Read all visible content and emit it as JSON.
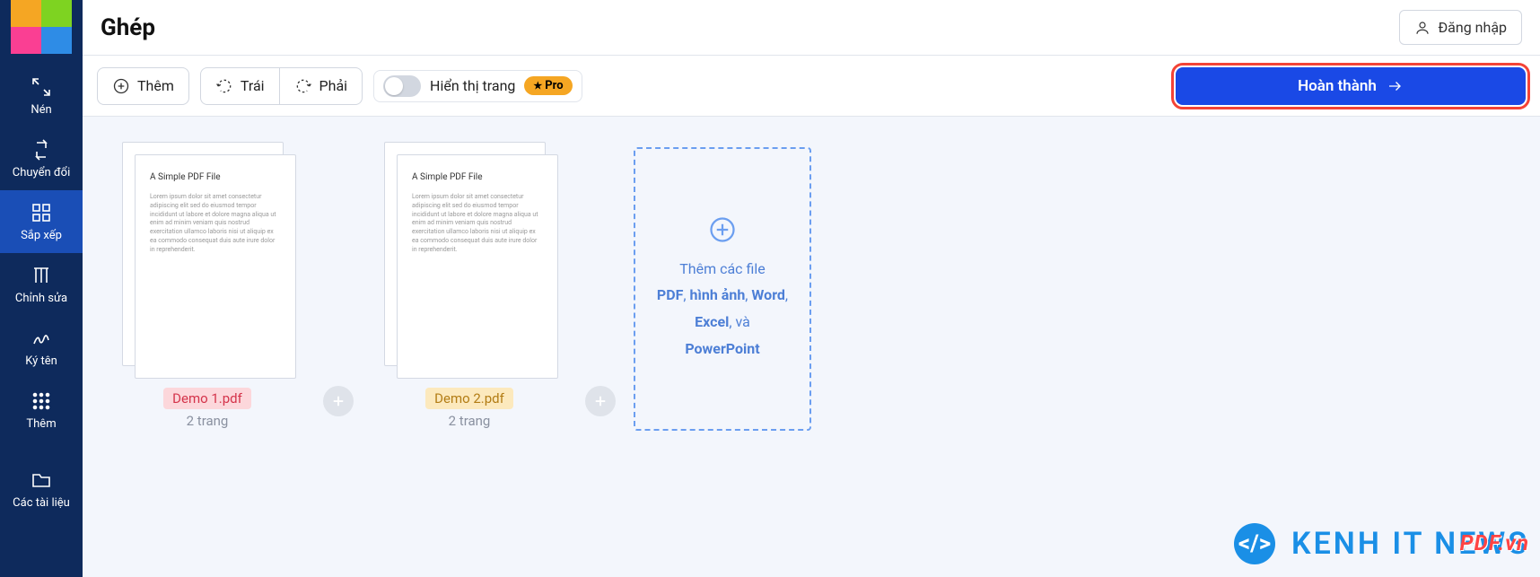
{
  "header": {
    "title": "Ghép",
    "login": "Đăng nhập"
  },
  "toolbar": {
    "add": "Thêm",
    "rotate_left": "Trái",
    "rotate_right": "Phải",
    "toggle_label": "Hiển thị trang",
    "pro": "Pro",
    "finish": "Hoàn thành"
  },
  "sidebar": {
    "items": [
      {
        "label": "Nén"
      },
      {
        "label": "Chuyển đổi"
      },
      {
        "label": "Sắp xếp"
      },
      {
        "label": "Chỉnh sửa"
      },
      {
        "label": "Ký tên"
      },
      {
        "label": "Thêm"
      },
      {
        "label": "Các tài liệu"
      }
    ]
  },
  "files": [
    {
      "name": "Demo 1.pdf",
      "pages": "2 trang",
      "color": "red",
      "sample_title": "A Simple PDF File"
    },
    {
      "name": "Demo 2.pdf",
      "pages": "2 trang",
      "color": "yellow",
      "sample_title": "A Simple PDF File"
    }
  ],
  "dropzone": {
    "line1": "Thêm các file",
    "pdf": "PDF",
    "sep1": ", ",
    "img": "hình ảnh",
    "sep2": ", ",
    "word": "Word",
    "sep3": ", ",
    "excel": "Excel",
    "and": ", và",
    "ppt": "PowerPoint"
  },
  "watermark": {
    "text": "KENH IT NEWS",
    "stamp": "PDF.vn"
  }
}
